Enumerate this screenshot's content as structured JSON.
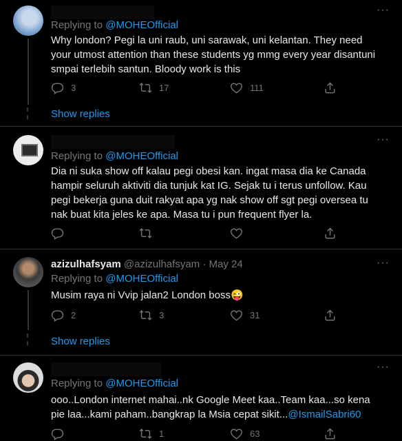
{
  "more_label": "···",
  "tweets": [
    {
      "reply_prefix": "Replying to ",
      "reply_to": "@MOHEOfficial",
      "text": "Why london? Pegi la uni raub, uni sarawak, uni kelantan. They need your utmost attention than these students yg mmg every year disantuni smpai terlebih santun. Bloody work is this",
      "replies": "3",
      "retweets": "17",
      "likes": "111",
      "show_replies": "Show replies"
    },
    {
      "reply_prefix": "Replying to ",
      "reply_to": "@MOHEOfficial",
      "text": "Dia ni suka show off kalau pegi obesi kan.  ingat masa dia ke Canada hampir seluruh aktiviti dia tunjuk kat IG. Sejak tu i terus unfollow. Kau pegi bekerja guna duit rakyat apa yg nak show off sgt pegi oversea tu nak buat kita jeles ke apa. Masa tu i pun frequent flyer la."
    },
    {
      "name": "azizulhafsyam",
      "handle": "@azizulhafsyam · May 24",
      "reply_prefix": "Replying to ",
      "reply_to": "@MOHEOfficial",
      "text": "Musim raya ni Vvip jalan2 London boss😜",
      "replies": "2",
      "retweets": "3",
      "likes": "31",
      "show_replies": "Show replies"
    },
    {
      "reply_prefix": "Replying to ",
      "reply_to": "@MOHEOfficial",
      "text": "ooo..London internet mahai..nk Google Meet kaa..Team kaa...so kena pie laa...kami paham..bangkrap la Msia cepat sikit...",
      "mention": "@IsmailSabri60",
      "retweets": "1",
      "likes": "63"
    }
  ]
}
